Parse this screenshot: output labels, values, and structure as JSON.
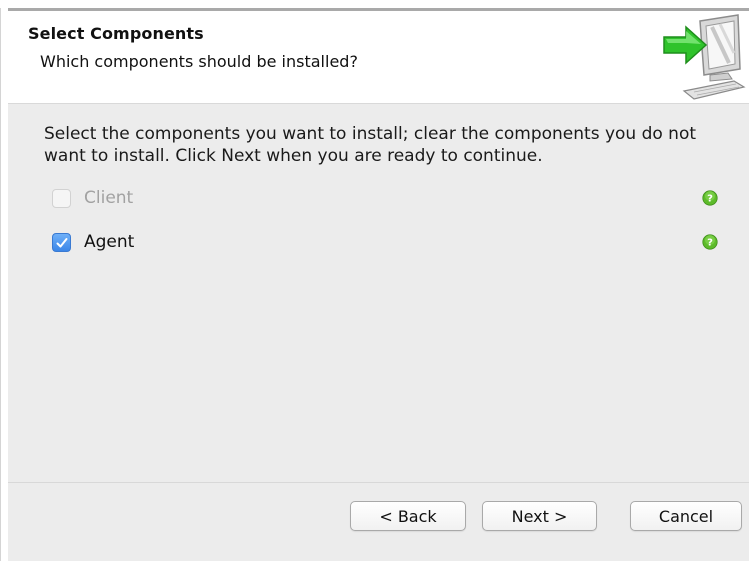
{
  "header": {
    "title": "Select Components",
    "subtitle": "Which components should be installed?",
    "icon": "computer-with-arrow-icon"
  },
  "instructions": "Select the components you want to install; clear the components you do not want to install. Click Next when you are ready to continue.",
  "components": [
    {
      "label": "Client",
      "checked": false,
      "enabled": false,
      "help_icon": "help-icon"
    },
    {
      "label": "Agent",
      "checked": true,
      "enabled": true,
      "help_icon": "help-icon"
    }
  ],
  "buttons": {
    "back": "< Back",
    "next": "Next >",
    "cancel": "Cancel"
  },
  "colors": {
    "checkbox_checked": "#3b86e8",
    "help_green": "#5dbb2a",
    "arrow_green": "#2fc32b",
    "panel_bg": "#ececec"
  }
}
